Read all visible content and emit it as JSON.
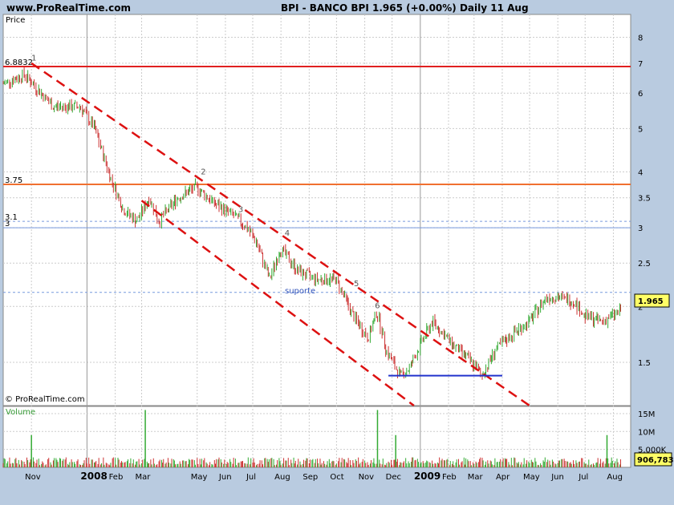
{
  "header": {
    "site": "www.ProRealTime.com",
    "title": "BPI - BANCO BPI    1.965 (+0.00%)    Daily  11 Aug"
  },
  "colors": {
    "up": "#33aa33",
    "down": "#cc3333",
    "trend": "#dd1111",
    "resist_top": "#e02020",
    "resist_mid": "#f07030",
    "support": "#2233cc",
    "dotted": "#7799dd",
    "grid": "#cccccc",
    "plot_bg": "#ffffff",
    "last_price_bg": "#ffff66"
  },
  "chart_data": {
    "type": "candlestick",
    "ylabel": "Price",
    "scale": "log",
    "ylim": [
      1.2,
      9.0
    ],
    "y_ticks": [
      8,
      7,
      6,
      5,
      4,
      3.5,
      3,
      2.5,
      2,
      1.5
    ],
    "x_ticks": [
      "Nov",
      "2008",
      "Feb",
      "Mar",
      "May",
      "Jun",
      "Jul",
      "Aug",
      "Sep",
      "Oct",
      "Nov",
      "Dec",
      "2009",
      "Feb",
      "Mar",
      "Apr",
      "May",
      "Jun",
      "Jul",
      "Aug"
    ],
    "last_price": "1.965",
    "price_path": [
      [
        "2007-10-01",
        6.3
      ],
      [
        "2007-10-25",
        6.6
      ],
      [
        "2007-11-25",
        5.6
      ],
      [
        "2007-12-25",
        5.6
      ],
      [
        "2008-01-10",
        5.0
      ],
      [
        "2008-01-25",
        4.0
      ],
      [
        "2008-02-10",
        3.3
      ],
      [
        "2008-02-25",
        3.1
      ],
      [
        "2008-03-10",
        3.5
      ],
      [
        "2008-03-20",
        3.1
      ],
      [
        "2008-04-10",
        3.5
      ],
      [
        "2008-05-01",
        3.7
      ],
      [
        "2008-05-20",
        3.4
      ],
      [
        "2008-06-10",
        3.2
      ],
      [
        "2008-06-25",
        3.0
      ],
      [
        "2008-07-05",
        2.8
      ],
      [
        "2008-07-20",
        2.3
      ],
      [
        "2008-08-01",
        2.7
      ],
      [
        "2008-08-20",
        2.4
      ],
      [
        "2008-09-10",
        2.3
      ],
      [
        "2008-10-01",
        2.3
      ],
      [
        "2008-10-20",
        1.9
      ],
      [
        "2008-11-05",
        1.7
      ],
      [
        "2008-11-15",
        1.95
      ],
      [
        "2008-11-25",
        1.6
      ],
      [
        "2008-12-10",
        1.4
      ],
      [
        "2008-12-20",
        1.45
      ],
      [
        "2009-01-05",
        1.7
      ],
      [
        "2009-01-15",
        1.85
      ],
      [
        "2009-02-05",
        1.65
      ],
      [
        "2009-02-20",
        1.55
      ],
      [
        "2009-03-05",
        1.45
      ],
      [
        "2009-03-10",
        1.4
      ],
      [
        "2009-03-25",
        1.6
      ],
      [
        "2009-04-15",
        1.75
      ],
      [
        "2009-05-01",
        1.85
      ],
      [
        "2009-05-20",
        2.1
      ],
      [
        "2009-06-01",
        2.1
      ],
      [
        "2009-06-20",
        2.05
      ],
      [
        "2009-07-01",
        1.9
      ],
      [
        "2009-07-20",
        1.85
      ],
      [
        "2009-08-11",
        1.965
      ]
    ],
    "volume_ylim": [
      0,
      17000000
    ],
    "volume_ticks": [
      {
        "label": "15M",
        "value": 15000000
      },
      {
        "label": "10M",
        "value": 10000000
      },
      {
        "label": "5,000K",
        "value": 5000000
      }
    ],
    "last_volume": "906,783",
    "volume_label": "Volume",
    "volume_spikes": [
      [
        "2007-11-01",
        9000000
      ],
      [
        "2008-03-05",
        16000000
      ],
      [
        "2008-11-15",
        16000000
      ],
      [
        "2008-12-05",
        9000000
      ],
      [
        "2009-07-25",
        9000000
      ]
    ],
    "horizontal_lines": [
      {
        "label": "6.8832",
        "value": 6.8832,
        "color": "#e02020",
        "style": "solid"
      },
      {
        "label": "3.75",
        "value": 3.75,
        "color": "#f07030",
        "style": "solid"
      },
      {
        "label": "3.1",
        "value": 3.1,
        "color": "#7799dd",
        "style": "dotted"
      },
      {
        "label": "3",
        "value": 3.0,
        "color": "#7799dd",
        "style": "solid"
      },
      {
        "label": "",
        "value": 2.15,
        "color": "#7799dd",
        "style": "dotted"
      }
    ],
    "trendlines": [
      {
        "from": [
          "2007-11-01",
          7.0
        ],
        "to": [
          "2009-05-01",
          1.2
        ],
        "style": "dashed"
      },
      {
        "from": [
          "2008-03-01",
          3.45
        ],
        "to": [
          "2008-12-25",
          1.2
        ],
        "style": "dashed"
      }
    ],
    "support_line": {
      "from": [
        "2008-11-27",
        1.4
      ],
      "to": [
        "2009-04-01",
        1.4
      ]
    },
    "marker_labels": [
      {
        "text": "1",
        "at": [
          "2007-11-01",
          7.1
        ]
      },
      {
        "text": "2",
        "at": [
          "2008-05-05",
          3.95
        ]
      },
      {
        "text": "3",
        "at": [
          "2008-06-15",
          3.25
        ]
      },
      {
        "text": "4",
        "at": [
          "2008-08-05",
          2.88
        ]
      },
      {
        "text": "5",
        "at": [
          "2008-10-20",
          2.22
        ]
      },
      {
        "text": "6",
        "at": [
          "2008-11-12",
          1.98
        ]
      }
    ],
    "annotation_suporte": {
      "text": "suporte",
      "at": [
        "2008-08-10",
        2.11
      ]
    },
    "copyright": "© ProRealTime.com"
  }
}
